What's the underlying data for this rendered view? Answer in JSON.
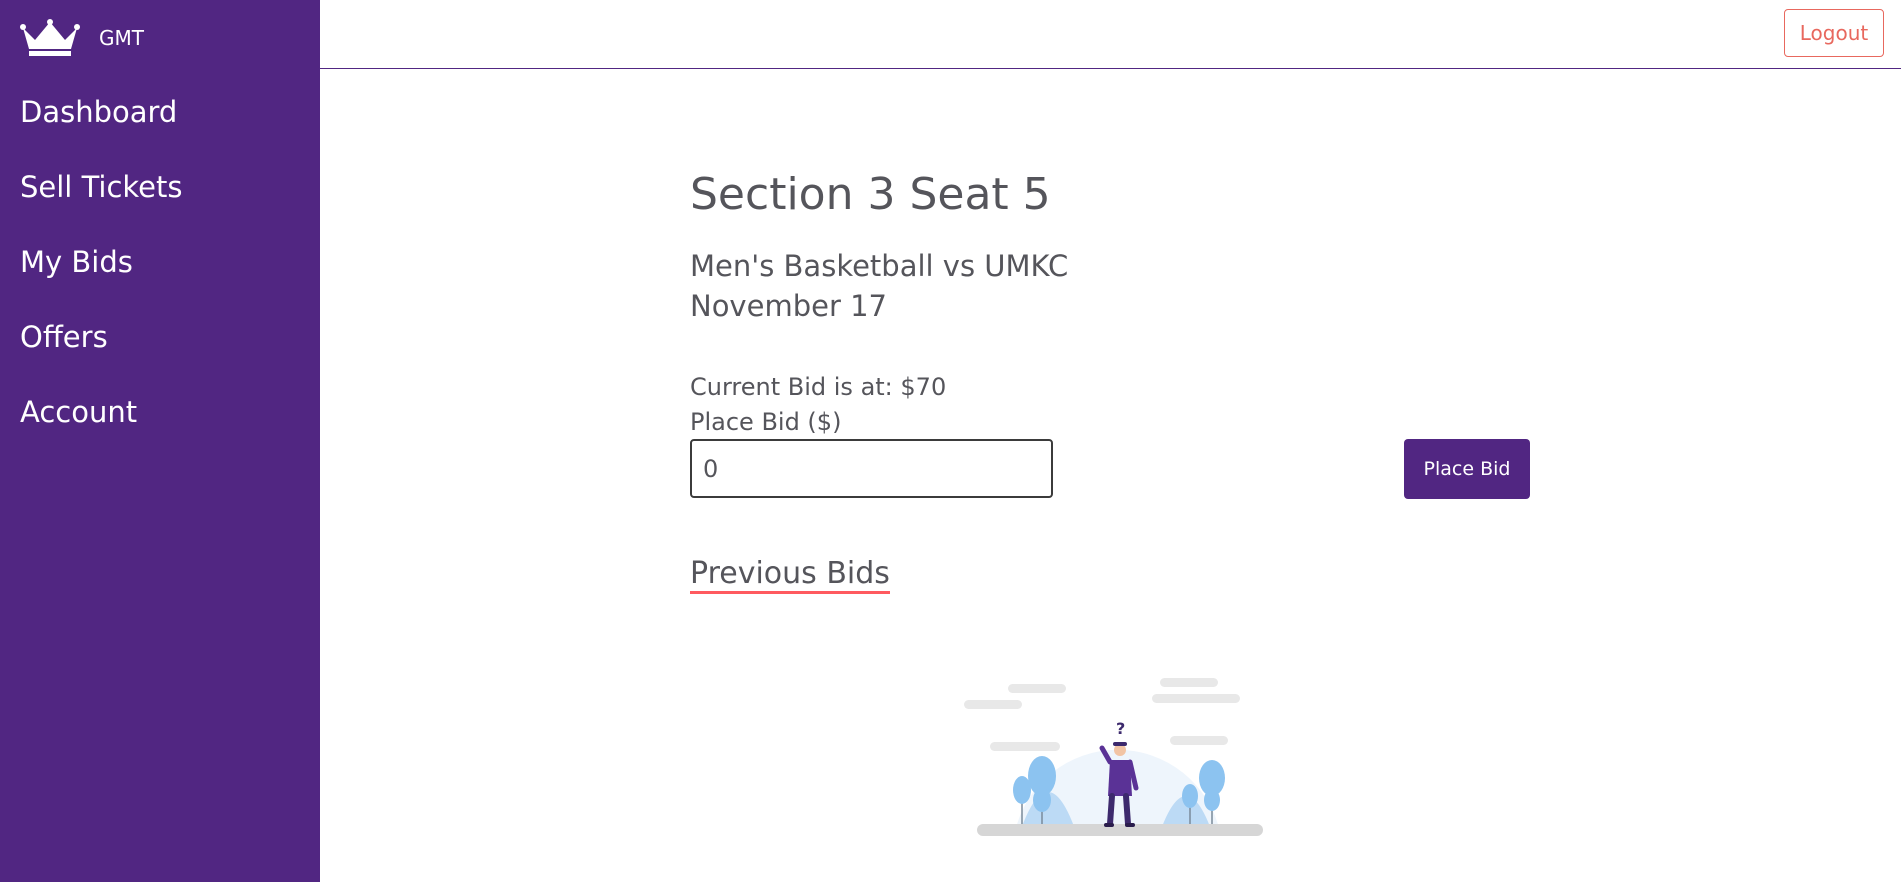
{
  "brand": {
    "name": "GMT",
    "logo_icon": "crown-icon"
  },
  "sidebar": {
    "items": [
      {
        "label": "Dashboard"
      },
      {
        "label": "Sell Tickets"
      },
      {
        "label": "My Bids"
      },
      {
        "label": "Offers"
      },
      {
        "label": "Account"
      }
    ]
  },
  "header": {
    "logout_label": "Logout"
  },
  "ticket": {
    "title": "Section 3 Seat 5",
    "event": "Men's Basketball vs UMKC",
    "date": "November 17"
  },
  "bid": {
    "current_text": "Current Bid is at: $70",
    "input_label": "Place Bid ($)",
    "input_value": "0",
    "button_label": "Place Bid"
  },
  "previous_bids": {
    "heading": "Previous Bids",
    "empty_state_icon": "empty-state-illustration"
  },
  "colors": {
    "sidebar": "#512682",
    "accent": "#512682",
    "logout": "#e8685e",
    "underline": "#ff5a5f",
    "text": "#55555b"
  }
}
